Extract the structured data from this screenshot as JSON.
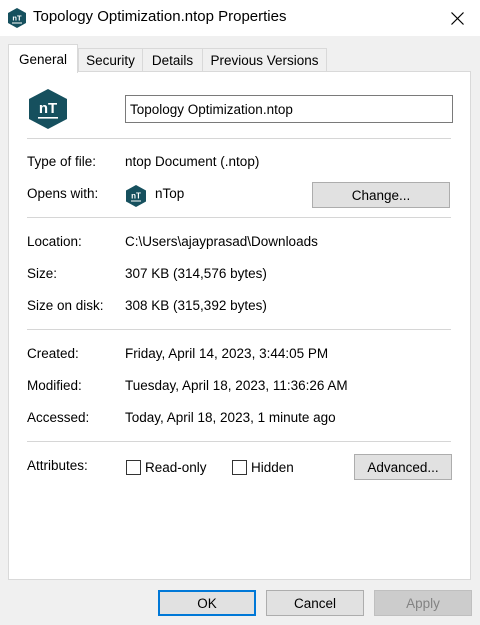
{
  "window": {
    "title": "Topology Optimization.ntop Properties"
  },
  "tabs": [
    {
      "label": "General",
      "active": true
    },
    {
      "label": "Security",
      "active": false
    },
    {
      "label": "Details",
      "active": false
    },
    {
      "label": "Previous Versions",
      "active": false
    }
  ],
  "general": {
    "file_name": "Topology Optimization.ntop",
    "type_of_file_label": "Type of file:",
    "type_of_file": "ntop Document (.ntop)",
    "opens_with_label": "Opens with:",
    "opens_with_app": "nTop",
    "change_button": "Change...",
    "location_label": "Location:",
    "location": "C:\\Users\\ajayprasad\\Downloads",
    "size_label": "Size:",
    "size": "307 KB (314,576 bytes)",
    "size_on_disk_label": "Size on disk:",
    "size_on_disk": "308 KB (315,392 bytes)",
    "created_label": "Created:",
    "created": "Friday, April 14, 2023, 3:44:05 PM",
    "modified_label": "Modified:",
    "modified": "Tuesday, April 18, 2023, 11:36:26 AM",
    "accessed_label": "Accessed:",
    "accessed": "Today, April 18, 2023, 1 minute ago",
    "attributes_label": "Attributes:",
    "readonly_label": "Read-only",
    "readonly_checked": false,
    "hidden_label": "Hidden",
    "hidden_checked": false,
    "advanced_button": "Advanced..."
  },
  "footer": {
    "ok": "OK",
    "cancel": "Cancel",
    "apply": "Apply"
  },
  "colors": {
    "accent": "#0078d7",
    "app_icon_bg": "#16505e"
  },
  "icons": {
    "app": "ntop-logo-icon",
    "close": "close-icon"
  }
}
